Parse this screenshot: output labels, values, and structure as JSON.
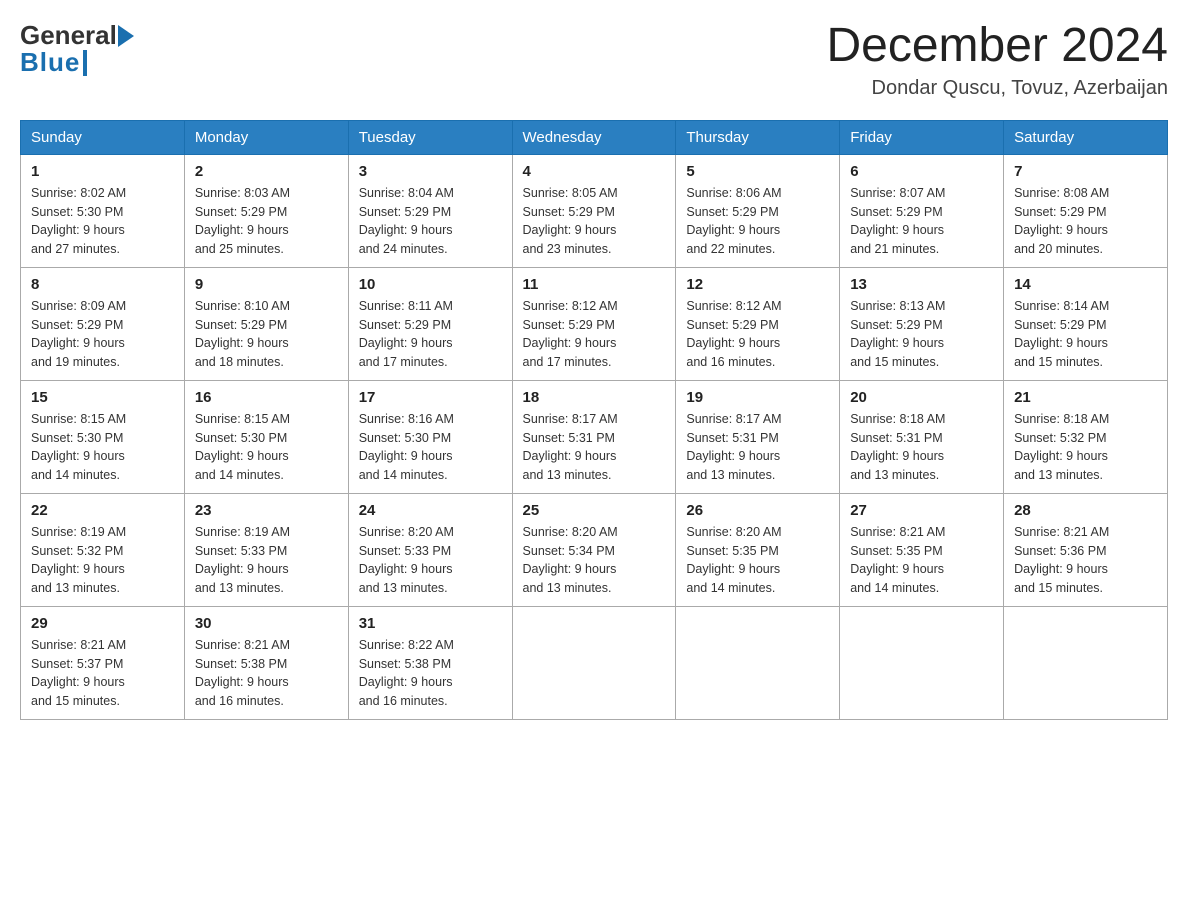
{
  "header": {
    "logo_general": "General",
    "logo_blue": "Blue",
    "month_title": "December 2024",
    "location": "Dondar Quscu, Tovuz, Azerbaijan"
  },
  "weekdays": [
    "Sunday",
    "Monday",
    "Tuesday",
    "Wednesday",
    "Thursday",
    "Friday",
    "Saturday"
  ],
  "weeks": [
    [
      {
        "day": "1",
        "sunrise": "8:02 AM",
        "sunset": "5:30 PM",
        "daylight": "9 hours and 27 minutes."
      },
      {
        "day": "2",
        "sunrise": "8:03 AM",
        "sunset": "5:29 PM",
        "daylight": "9 hours and 25 minutes."
      },
      {
        "day": "3",
        "sunrise": "8:04 AM",
        "sunset": "5:29 PM",
        "daylight": "9 hours and 24 minutes."
      },
      {
        "day": "4",
        "sunrise": "8:05 AM",
        "sunset": "5:29 PM",
        "daylight": "9 hours and 23 minutes."
      },
      {
        "day": "5",
        "sunrise": "8:06 AM",
        "sunset": "5:29 PM",
        "daylight": "9 hours and 22 minutes."
      },
      {
        "day": "6",
        "sunrise": "8:07 AM",
        "sunset": "5:29 PM",
        "daylight": "9 hours and 21 minutes."
      },
      {
        "day": "7",
        "sunrise": "8:08 AM",
        "sunset": "5:29 PM",
        "daylight": "9 hours and 20 minutes."
      }
    ],
    [
      {
        "day": "8",
        "sunrise": "8:09 AM",
        "sunset": "5:29 PM",
        "daylight": "9 hours and 19 minutes."
      },
      {
        "day": "9",
        "sunrise": "8:10 AM",
        "sunset": "5:29 PM",
        "daylight": "9 hours and 18 minutes."
      },
      {
        "day": "10",
        "sunrise": "8:11 AM",
        "sunset": "5:29 PM",
        "daylight": "9 hours and 17 minutes."
      },
      {
        "day": "11",
        "sunrise": "8:12 AM",
        "sunset": "5:29 PM",
        "daylight": "9 hours and 17 minutes."
      },
      {
        "day": "12",
        "sunrise": "8:12 AM",
        "sunset": "5:29 PM",
        "daylight": "9 hours and 16 minutes."
      },
      {
        "day": "13",
        "sunrise": "8:13 AM",
        "sunset": "5:29 PM",
        "daylight": "9 hours and 15 minutes."
      },
      {
        "day": "14",
        "sunrise": "8:14 AM",
        "sunset": "5:29 PM",
        "daylight": "9 hours and 15 minutes."
      }
    ],
    [
      {
        "day": "15",
        "sunrise": "8:15 AM",
        "sunset": "5:30 PM",
        "daylight": "9 hours and 14 minutes."
      },
      {
        "day": "16",
        "sunrise": "8:15 AM",
        "sunset": "5:30 PM",
        "daylight": "9 hours and 14 minutes."
      },
      {
        "day": "17",
        "sunrise": "8:16 AM",
        "sunset": "5:30 PM",
        "daylight": "9 hours and 14 minutes."
      },
      {
        "day": "18",
        "sunrise": "8:17 AM",
        "sunset": "5:31 PM",
        "daylight": "9 hours and 13 minutes."
      },
      {
        "day": "19",
        "sunrise": "8:17 AM",
        "sunset": "5:31 PM",
        "daylight": "9 hours and 13 minutes."
      },
      {
        "day": "20",
        "sunrise": "8:18 AM",
        "sunset": "5:31 PM",
        "daylight": "9 hours and 13 minutes."
      },
      {
        "day": "21",
        "sunrise": "8:18 AM",
        "sunset": "5:32 PM",
        "daylight": "9 hours and 13 minutes."
      }
    ],
    [
      {
        "day": "22",
        "sunrise": "8:19 AM",
        "sunset": "5:32 PM",
        "daylight": "9 hours and 13 minutes."
      },
      {
        "day": "23",
        "sunrise": "8:19 AM",
        "sunset": "5:33 PM",
        "daylight": "9 hours and 13 minutes."
      },
      {
        "day": "24",
        "sunrise": "8:20 AM",
        "sunset": "5:33 PM",
        "daylight": "9 hours and 13 minutes."
      },
      {
        "day": "25",
        "sunrise": "8:20 AM",
        "sunset": "5:34 PM",
        "daylight": "9 hours and 13 minutes."
      },
      {
        "day": "26",
        "sunrise": "8:20 AM",
        "sunset": "5:35 PM",
        "daylight": "9 hours and 14 minutes."
      },
      {
        "day": "27",
        "sunrise": "8:21 AM",
        "sunset": "5:35 PM",
        "daylight": "9 hours and 14 minutes."
      },
      {
        "day": "28",
        "sunrise": "8:21 AM",
        "sunset": "5:36 PM",
        "daylight": "9 hours and 15 minutes."
      }
    ],
    [
      {
        "day": "29",
        "sunrise": "8:21 AM",
        "sunset": "5:37 PM",
        "daylight": "9 hours and 15 minutes."
      },
      {
        "day": "30",
        "sunrise": "8:21 AM",
        "sunset": "5:38 PM",
        "daylight": "9 hours and 16 minutes."
      },
      {
        "day": "31",
        "sunrise": "8:22 AM",
        "sunset": "5:38 PM",
        "daylight": "9 hours and 16 minutes."
      },
      null,
      null,
      null,
      null
    ]
  ],
  "labels": {
    "sunrise": "Sunrise:",
    "sunset": "Sunset:",
    "daylight": "Daylight:"
  }
}
